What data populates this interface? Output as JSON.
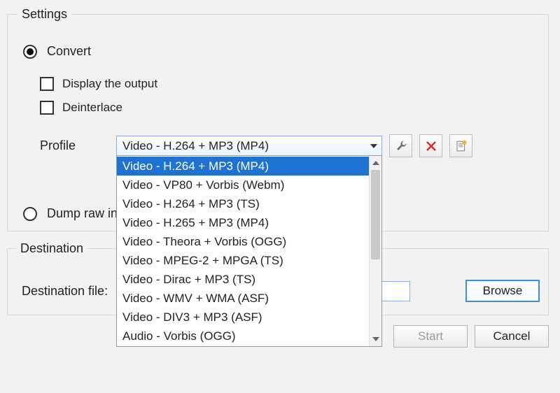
{
  "settings": {
    "legend": "Settings",
    "convert_label": "Convert",
    "display_output_label": "Display the output",
    "deinterlace_label": "Deinterlace",
    "profile_label": "Profile",
    "dump_raw_label": "Dump raw in",
    "icons": {
      "wrench": "wrench-icon",
      "delete": "delete-icon",
      "new_profile": "new-profile-icon"
    }
  },
  "profile": {
    "selected": "Video - H.264 + MP3 (MP4)",
    "options": [
      "Video - H.264 + MP3 (MP4)",
      "Video - VP80 + Vorbis (Webm)",
      "Video - H.264 + MP3 (TS)",
      "Video - H.265 + MP3 (MP4)",
      "Video - Theora + Vorbis (OGG)",
      "Video - MPEG-2 + MPGA (TS)",
      "Video - Dirac + MP3 (TS)",
      "Video - WMV + WMA (ASF)",
      "Video - DIV3 + MP3 (ASF)",
      "Audio - Vorbis (OGG)"
    ]
  },
  "destination": {
    "legend": "Destination",
    "file_label": "Destination file:",
    "file_value": "",
    "browse_label": "Browse"
  },
  "buttons": {
    "start": "Start",
    "cancel": "Cancel"
  }
}
